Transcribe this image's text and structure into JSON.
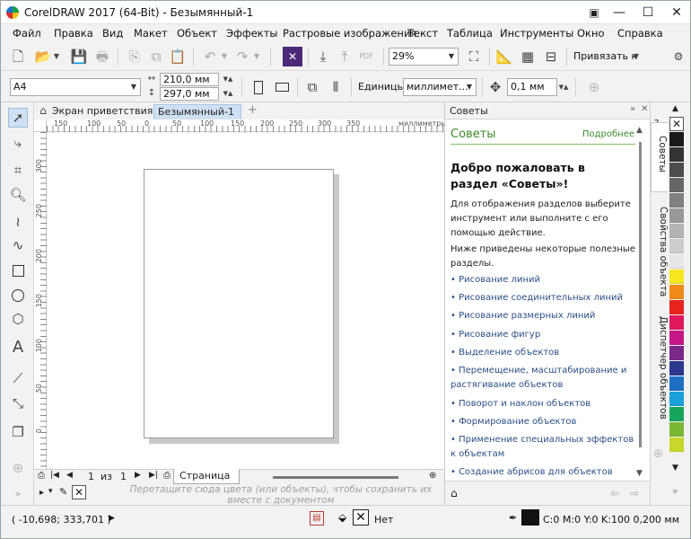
{
  "window": {
    "title": "CorelDRAW 2017 (64-Bit) - Безымянный-1",
    "controls": {
      "minimize": "—",
      "maximize": "☐",
      "close": "✕"
    }
  },
  "menu": [
    "Файл",
    "Правка",
    "Вид",
    "Макет",
    "Объект",
    "Эффекты",
    "Растровые изображения",
    "Текст",
    "Таблица",
    "Инструменты",
    "Окно",
    "Справка"
  ],
  "toolbar": {
    "zoom": "29%",
    "snap_label": "Привязать к",
    "pdf_label": "PDF"
  },
  "propertybar": {
    "page_size": "A4",
    "width": "210,0 мм",
    "height": "297,0 мм",
    "units_label": "Единицы:",
    "units_value": "миллимет...",
    "nudge": "0,1 мм"
  },
  "tabs": {
    "welcome": "Экран приветствия",
    "document": "Безымянный-1",
    "add": "+"
  },
  "ruler": {
    "h_ticks": [
      "150",
      "100",
      "50",
      "0",
      "50",
      "100",
      "150",
      "200",
      "250",
      "300",
      "350"
    ],
    "h_unit": "миллиметры",
    "v_ticks": [
      "300",
      "250",
      "200",
      "150",
      "100",
      "50",
      "0"
    ]
  },
  "pagenav": {
    "current": "1",
    "of": "из",
    "total": "1",
    "page_tab": "Страница 1"
  },
  "document_palette_hint": "Перетащите сюда цвета (или объекты), чтобы сохранить их вместе с документом",
  "docker": {
    "header": "Советы",
    "title": "Советы",
    "more": "Подробнее",
    "heading": "Добро пожаловать в раздел «Советы»!",
    "para1": "Для отображения разделов выберите инструмент или выполните с его помощью действие.",
    "para2": "Ниже приведены некоторые полезные разделы.",
    "links": [
      "• Рисование линий",
      "• Рисование соединительных линий",
      "• Рисование размерных линий",
      "• Рисование фигур",
      "• Выделение объектов",
      "• Перемещение, масштабирование и растягивание объектов",
      "• Поворот и наклон объектов",
      "• Формирование объектов",
      "• Применение специальных эффектов к объектам",
      "• Создание абрисов для объектов"
    ]
  },
  "docker_tabs": [
    "Советы",
    "Свойства объекта",
    "Диспетчер объектов"
  ],
  "palette": [
    "#ffffff",
    "#1a1a1a",
    "#333333",
    "#4d4d4d",
    "#666666",
    "#808080",
    "#999999",
    "#b3b3b3",
    "#cccccc",
    "#e6e6e6",
    "#f5e61e",
    "#f08a1a",
    "#e8231e",
    "#e2185e",
    "#c51887",
    "#7b2a8a",
    "#2b3a8f",
    "#1e6fc2",
    "#1ba0d8",
    "#16a65a",
    "#7ab733",
    "#c9d62d"
  ],
  "status": {
    "coords": "( -10,698; 333,701 )",
    "fill_label": "Нет",
    "outline": "C:0 M:0 Y:0 K:100  0,200 мм"
  },
  "colors": {
    "accent_green": "#3a8a2a",
    "link_blue": "#2a4f86",
    "tab_blue": "#cfe0f3"
  }
}
